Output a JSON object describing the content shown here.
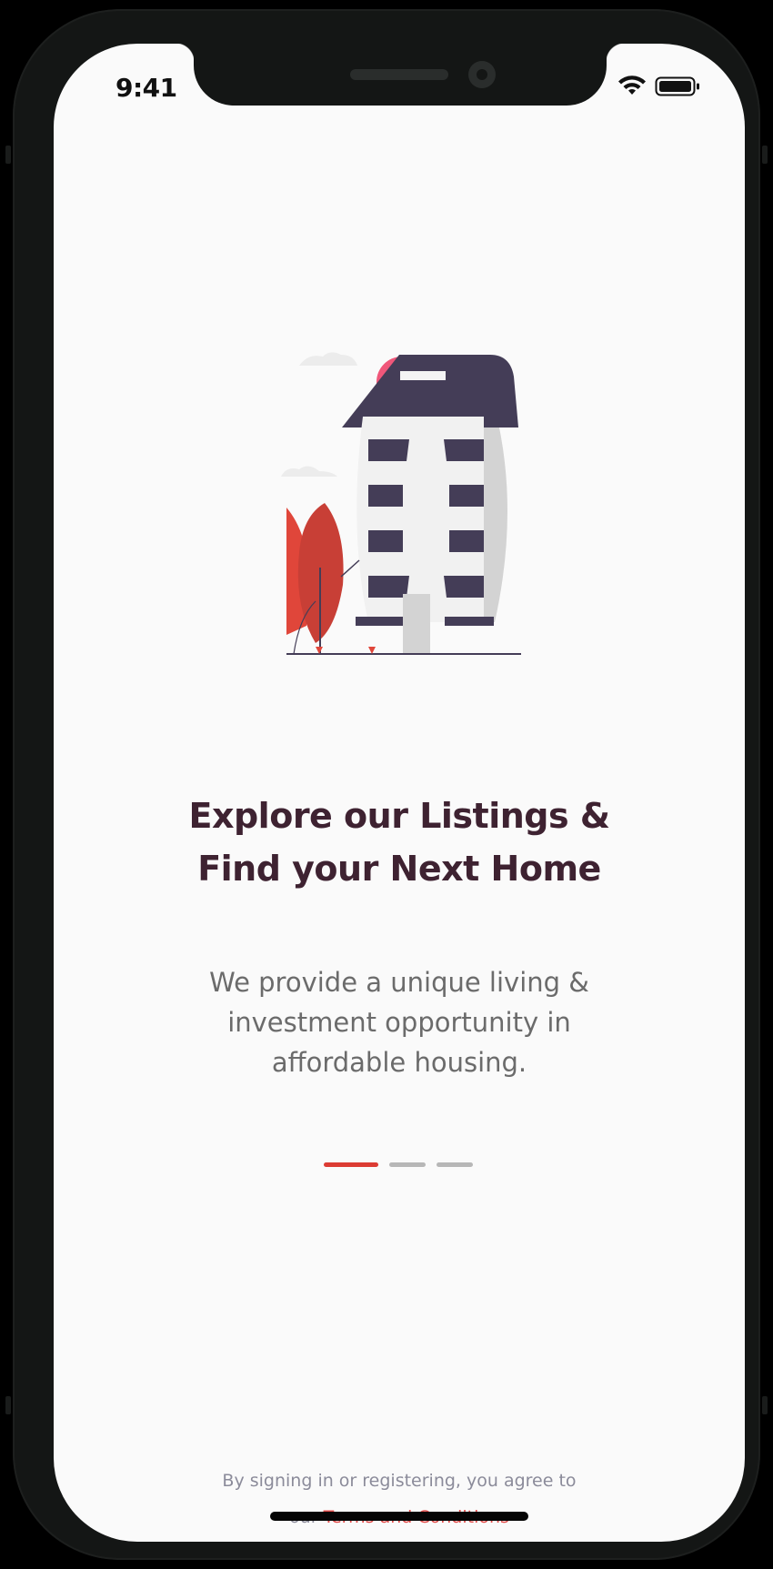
{
  "status_bar": {
    "time": "9:41",
    "icons": [
      "wifi-icon",
      "battery-icon"
    ]
  },
  "illustration": {
    "name": "apartment-building-illustration"
  },
  "onboarding": {
    "title_line1": "Explore our Listings &",
    "title_line2": "Find your Next Home",
    "subtitle_line1": "We provide a unique living &",
    "subtitle_line2": "investment opportunity in",
    "subtitle_line3": "affordable housing.",
    "page_count": 3,
    "current_page": 1
  },
  "legal": {
    "line1": "By signing in or registering, you agree to",
    "prefix": "our",
    "link_label": "Terms and Conditions"
  },
  "colors": {
    "accent": "#dc3b33",
    "title": "#3e2231",
    "building_dark": "#443d57",
    "sun": "#f0577a"
  }
}
